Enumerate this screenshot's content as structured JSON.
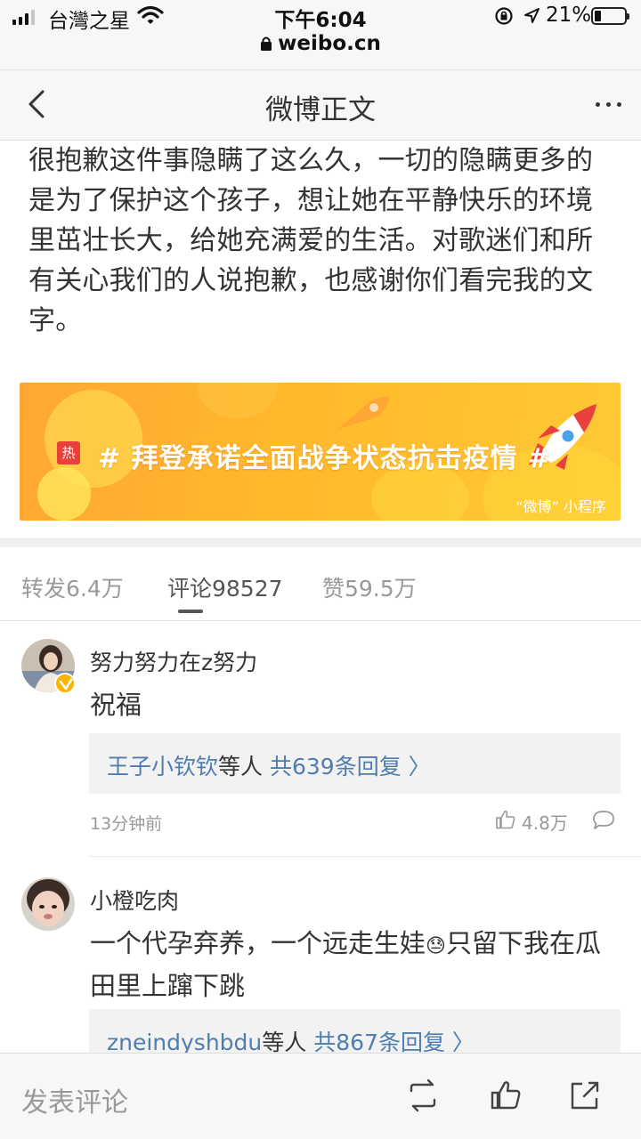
{
  "status_bar": {
    "carrier": "台灣之星",
    "time": "下午6:04",
    "battery": "21%",
    "battery_level": 0.21,
    "url": "weibo.cn"
  },
  "nav": {
    "title": "微博正文",
    "back_icon": "chevron-left-icon",
    "more_icon": "more-dots-icon"
  },
  "post": {
    "text": "很抱歉这件事隐瞒了这么久，一切的隐瞒更多的是为了保护这个孩子，想让她在平静快乐的环境里茁壮长大，给她充满爱的生活。对歌迷们和所有关心我们的人说抱歉，也感谢你们看完我的文字。"
  },
  "banner": {
    "hot_label": "热",
    "topic": "# 拜登承诺全面战争状态抗击疫情 #",
    "source": "“微博” 小程序",
    "colors": {
      "bg_start": "#ffa733",
      "bg_end": "#ffc934",
      "hot": "#e8403b"
    }
  },
  "tabs": [
    {
      "label": "转发6.4万",
      "active": false
    },
    {
      "label": "评论98527",
      "active": true
    },
    {
      "label": "赞59.5万",
      "active": false
    }
  ],
  "comments": [
    {
      "user": "努力努力在z努力",
      "verified": true,
      "text": "祝福",
      "reply_names": "王子小钦钦",
      "reply_mid": "等人",
      "reply_count": "共639条回复 〉",
      "time": "13分钟前",
      "likes": "4.8万"
    },
    {
      "user": "小橙吃肉",
      "verified": false,
      "text": "一个代孕弃养，一个远走生娃",
      "emoji": "😓",
      "text_after": "只留下我在瓜田里上蹿下跳",
      "reply_names": "zneindyshbdu",
      "reply_mid": "等人",
      "reply_count": "共867条回复 〉"
    }
  ],
  "bottom_bar": {
    "input_placeholder": "发表评论",
    "icons": [
      "repost-icon",
      "like-icon",
      "share-icon"
    ]
  },
  "colors": {
    "link": "#507daf",
    "muted": "#999999",
    "bar_bg": "#f7f7f7"
  }
}
